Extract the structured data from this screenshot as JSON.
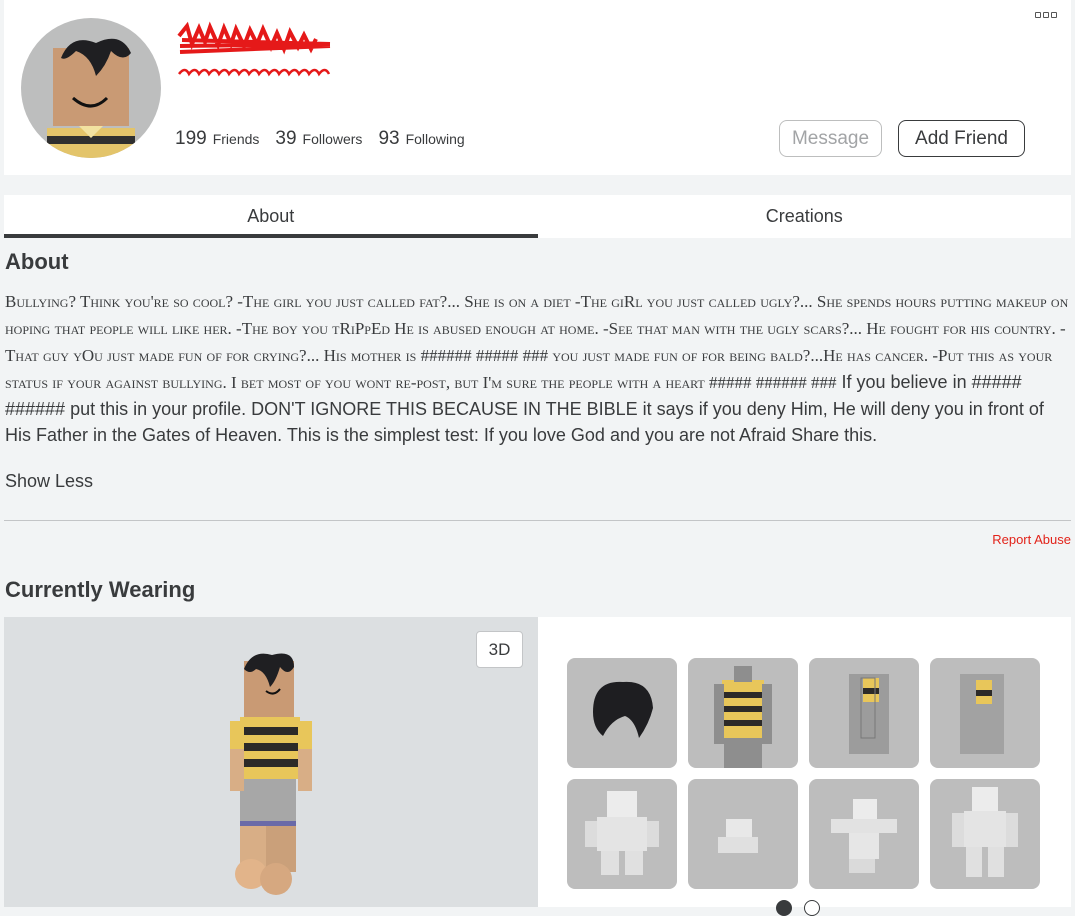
{
  "profile": {
    "stats": [
      {
        "value": "199",
        "label": "Friends"
      },
      {
        "value": "39",
        "label": "Followers"
      },
      {
        "value": "93",
        "label": "Following"
      }
    ],
    "message_label": "Message",
    "add_friend_label": "Add Friend"
  },
  "tabs": [
    {
      "label": "About",
      "active": true
    },
    {
      "label": "Creations",
      "active": false
    }
  ],
  "about": {
    "title": "About",
    "sc_text": "Bullying? Think you're so cool? -The girl you just called fat?... She is on a diet -The giRl you just called ugly?... She spends hours putting makeup on hoping that people will like her. -The boy you tRiPpEd He is abused enough at home. -See that man with the ugly scars?... He fought for his country. -That guy yOu just made fun of for crying?... His mother is ###### ##### ### you just made fun of for being bald?...He has cancer. -Put this as your status if your against bullying. I bet most of you wont re-post, but I'm sure the people with a heart ##### ###### ###",
    "plain_text": " If you believe in ##### ###### put this in your profile. DON'T IGNORE THIS BECAUSE IN THE BIBLE it says if you deny Him, He will deny you in front of His Father in the Gates of Heaven. This is the simplest test: If you love God and you are not Afraid Share this.",
    "show_less": "Show Less",
    "report_abuse": "Report Abuse"
  },
  "wearing": {
    "title": "Currently Wearing",
    "btn_3d": "3D",
    "items": [
      "hair-item",
      "shirt-item",
      "left-arm-item",
      "right-arm-item",
      "animation-pack-item",
      "climb-animation-item",
      "jump-animation-item",
      "idle-animation-item"
    ],
    "page_count": 2,
    "current_page": 1
  },
  "colors": {
    "accent_text": "#393b3d",
    "report_red": "#e2231a",
    "avatar_bg": "#bdbebe"
  }
}
